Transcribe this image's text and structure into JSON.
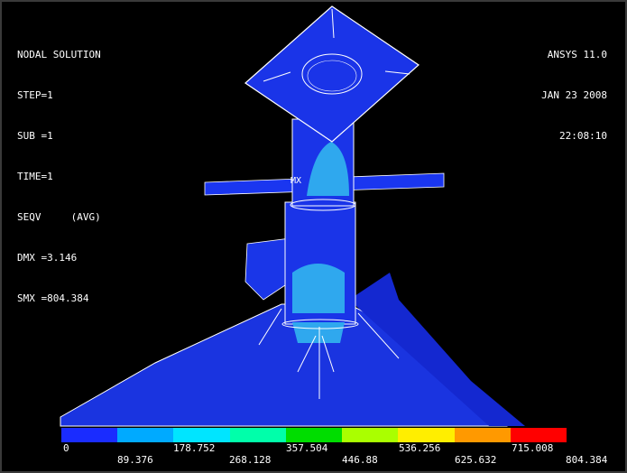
{
  "info": {
    "title": "NODAL SOLUTION",
    "step": "STEP=1",
    "sub": "SUB =1",
    "time": "TIME=1",
    "result": "SEQV     (AVG)",
    "dmx": "DMX =3.146",
    "smx": "SMX =804.384"
  },
  "header": {
    "product": "ANSYS 11.0",
    "date": "JAN 23 2008",
    "clock": "22:08:10"
  },
  "marker": {
    "label": "MX"
  },
  "legend": {
    "colors": [
      "#1a2cff",
      "#00aaff",
      "#00e5ff",
      "#00ffaa",
      "#00dd00",
      "#aaff00",
      "#ffee00",
      "#ff9900",
      "#ff0000"
    ],
    "top_labels": [
      "0",
      "178.752",
      "357.504",
      "536.256",
      "715.008"
    ],
    "bottom_labels": [
      "89.376",
      "268.128",
      "446.88",
      "625.632",
      "804.384"
    ]
  },
  "colors": {
    "background": "#000000",
    "base_blue": "#1530e8",
    "light_blue": "#2fa8ee",
    "outline": "#ffffff"
  }
}
